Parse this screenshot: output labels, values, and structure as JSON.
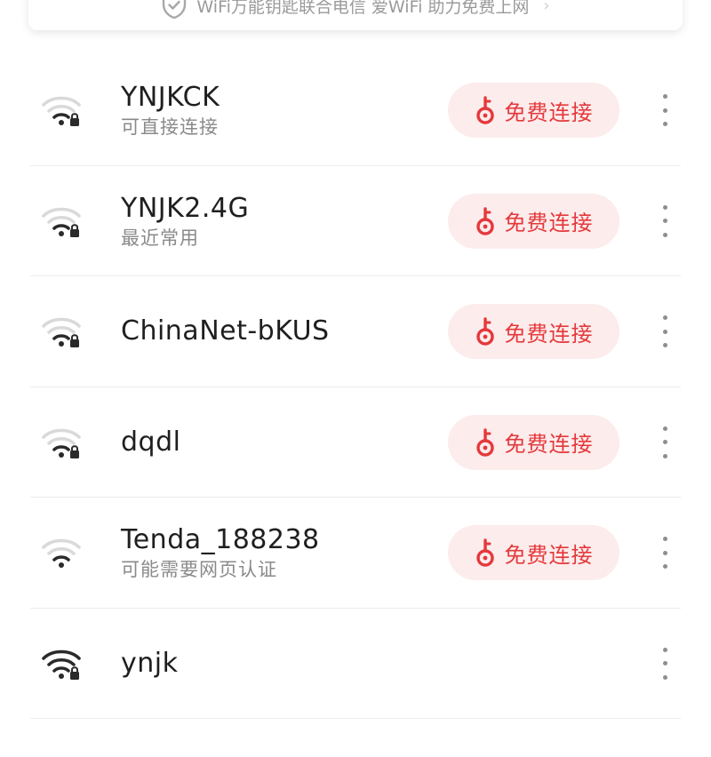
{
  "banner": {
    "text": "WiFi万能钥匙联合电信 爱WiFi 助力免费上网",
    "chevron": "›"
  },
  "connect_label": "免费连接",
  "colors": {
    "accent": "#e4393c",
    "button_bg": "#fdecec",
    "divider": "#ececec"
  },
  "networks": [
    {
      "ssid": "YNJKCK",
      "subtitle": "可直接连接",
      "signal": "weak",
      "locked": true,
      "has_connect": true
    },
    {
      "ssid": "YNJK2.4G",
      "subtitle": "最近常用",
      "signal": "weak",
      "locked": true,
      "has_connect": true
    },
    {
      "ssid": "ChinaNet-bKUS",
      "subtitle": "",
      "signal": "weak",
      "locked": true,
      "has_connect": true
    },
    {
      "ssid": "dqdl",
      "subtitle": "",
      "signal": "weak",
      "locked": true,
      "has_connect": true
    },
    {
      "ssid": "Tenda_188238",
      "subtitle": "可能需要网页认证",
      "signal": "weak",
      "locked": false,
      "has_connect": true
    },
    {
      "ssid": "ynjk",
      "subtitle": "",
      "signal": "full",
      "locked": true,
      "has_connect": false
    }
  ]
}
